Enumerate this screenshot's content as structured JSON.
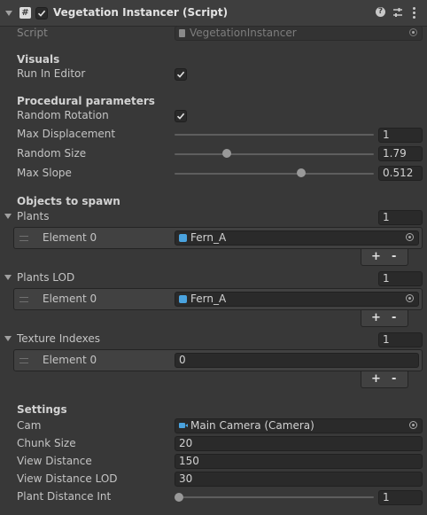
{
  "component": {
    "title": "Vegetation Instancer (Script)",
    "enabled": true,
    "script_label": "Script",
    "script_value": "VegetationInstancer"
  },
  "visuals": {
    "header": "Visuals",
    "run_in_editor_label": "Run In Editor",
    "run_in_editor": true
  },
  "procedural": {
    "header": "Procedural parameters",
    "random_rotation_label": "Random Rotation",
    "random_rotation": true,
    "max_displacement_label": "Max Displacement",
    "max_displacement": "1",
    "max_displacement_slider": 1.0,
    "random_size_label": "Random Size",
    "random_size": "1.79",
    "random_size_slider": 0.25,
    "max_slope_label": "Max Slope",
    "max_slope": "0.512",
    "max_slope_slider": 0.64
  },
  "objects": {
    "header": "Objects to spawn",
    "plants": {
      "label": "Plants",
      "count": "1",
      "element_label": "Element 0",
      "element_value": "Fern_A"
    },
    "plants_lod": {
      "label": "Plants LOD",
      "count": "1",
      "element_label": "Element 0",
      "element_value": "Fern_A"
    },
    "texture_indexes": {
      "label": "Texture Indexes",
      "count": "1",
      "element_label": "Element 0",
      "element_value": "0"
    },
    "plus": "+",
    "minus": "-"
  },
  "settings": {
    "header": "Settings",
    "cam_label": "Cam",
    "cam_value": "Main Camera (Camera)",
    "chunk_size_label": "Chunk Size",
    "chunk_size": "20",
    "view_distance_label": "View Distance",
    "view_distance": "150",
    "view_distance_lod_label": "View Distance LOD",
    "view_distance_lod": "30",
    "plant_distance_int_label": "Plant Distance Int",
    "plant_distance_int": "1",
    "plant_distance_int_slider": 0.0
  },
  "colors": {
    "background": "#383838",
    "header_bar": "#3e3e3e",
    "field": "#2a2a2a",
    "prefab_icon": "#4aa3df",
    "camera_icon": "#4aa3df"
  }
}
